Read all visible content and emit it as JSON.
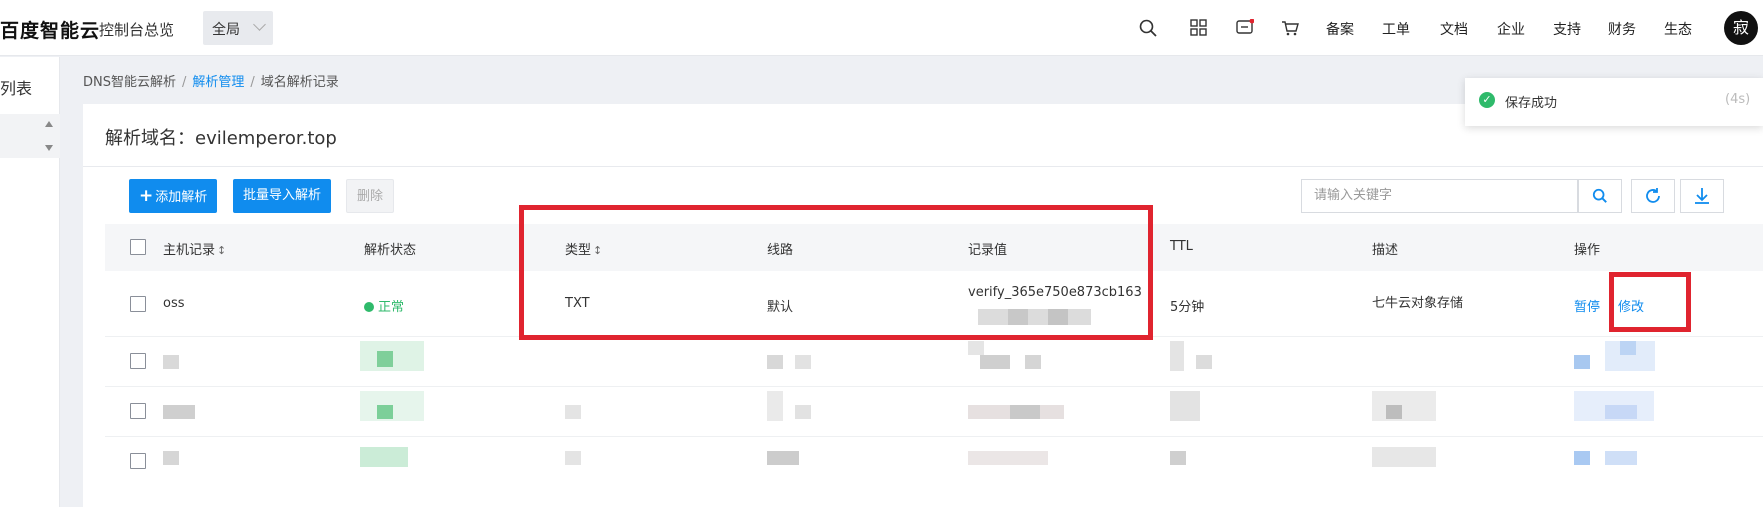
{
  "topbar": {
    "logo": "百度智能云",
    "overview": "控制台总览",
    "scope": "全局",
    "links": [
      "备案",
      "工单",
      "文档",
      "企业",
      "支持",
      "财务",
      "生态"
    ],
    "avatar": "寂"
  },
  "sidebar": {
    "label": "列表"
  },
  "breadcrumb": {
    "root": "DNS智能云解析",
    "mid": "解析管理",
    "current": "域名解析记录",
    "sep": "/"
  },
  "panel": {
    "title": "解析域名：evilemperor.top"
  },
  "toolbar": {
    "add": "添加解析",
    "import": "批量导入解析",
    "delete": "删除",
    "search_placeholder": "请输入关键字"
  },
  "table": {
    "headers": [
      "主机记录",
      "解析状态",
      "类型",
      "线路",
      "记录值",
      "TTL",
      "描述",
      "操作"
    ],
    "rows": [
      {
        "host": "oss",
        "status": "正常",
        "type": "TXT",
        "line": "默认",
        "value": "verify_365e750e873cb163",
        "ttl": "5分钟",
        "desc": "七牛云对象存储",
        "pause": "暂停",
        "edit": "修改"
      }
    ]
  },
  "toast": {
    "message": "保存成功",
    "timer": "(4s)"
  },
  "colors": {
    "accent": "#108cee",
    "success": "#2fba6b",
    "annotation": "#e0242f"
  }
}
